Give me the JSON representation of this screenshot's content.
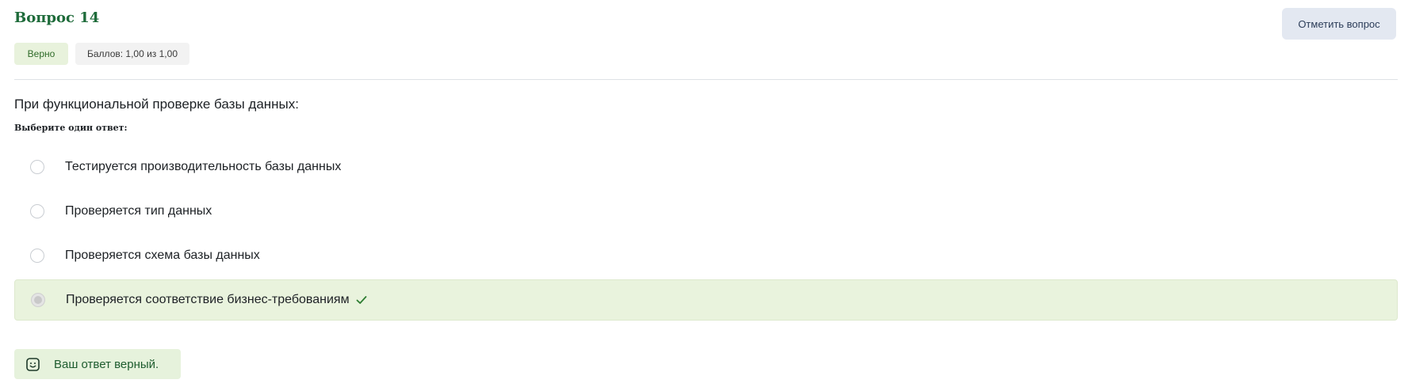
{
  "question": {
    "title": "Вопрос 14",
    "status_badge": "Верно",
    "score_badge": "Баллов: 1,00 из 1,00",
    "flag_button": "Отметить вопрос",
    "text": "При функциональной проверке базы данных:",
    "prompt": "Выберите один ответ:"
  },
  "answers": [
    {
      "label": "Тестируется производительность базы данных",
      "selected": false,
      "correct": false
    },
    {
      "label": "Проверяется тип данных",
      "selected": false,
      "correct": false
    },
    {
      "label": "Проверяется схема базы данных",
      "selected": false,
      "correct": false
    },
    {
      "label": "Проверяется соответствие бизнес-требованиям",
      "selected": true,
      "correct": true
    }
  ],
  "feedback": {
    "icon": "smile-icon",
    "text": "Ваш ответ верный."
  },
  "colors": {
    "title": "#1e6b3a",
    "correct_bg": "#e9f3dd",
    "check": "#2e7d32",
    "flag_bg": "#e3e8f1"
  }
}
